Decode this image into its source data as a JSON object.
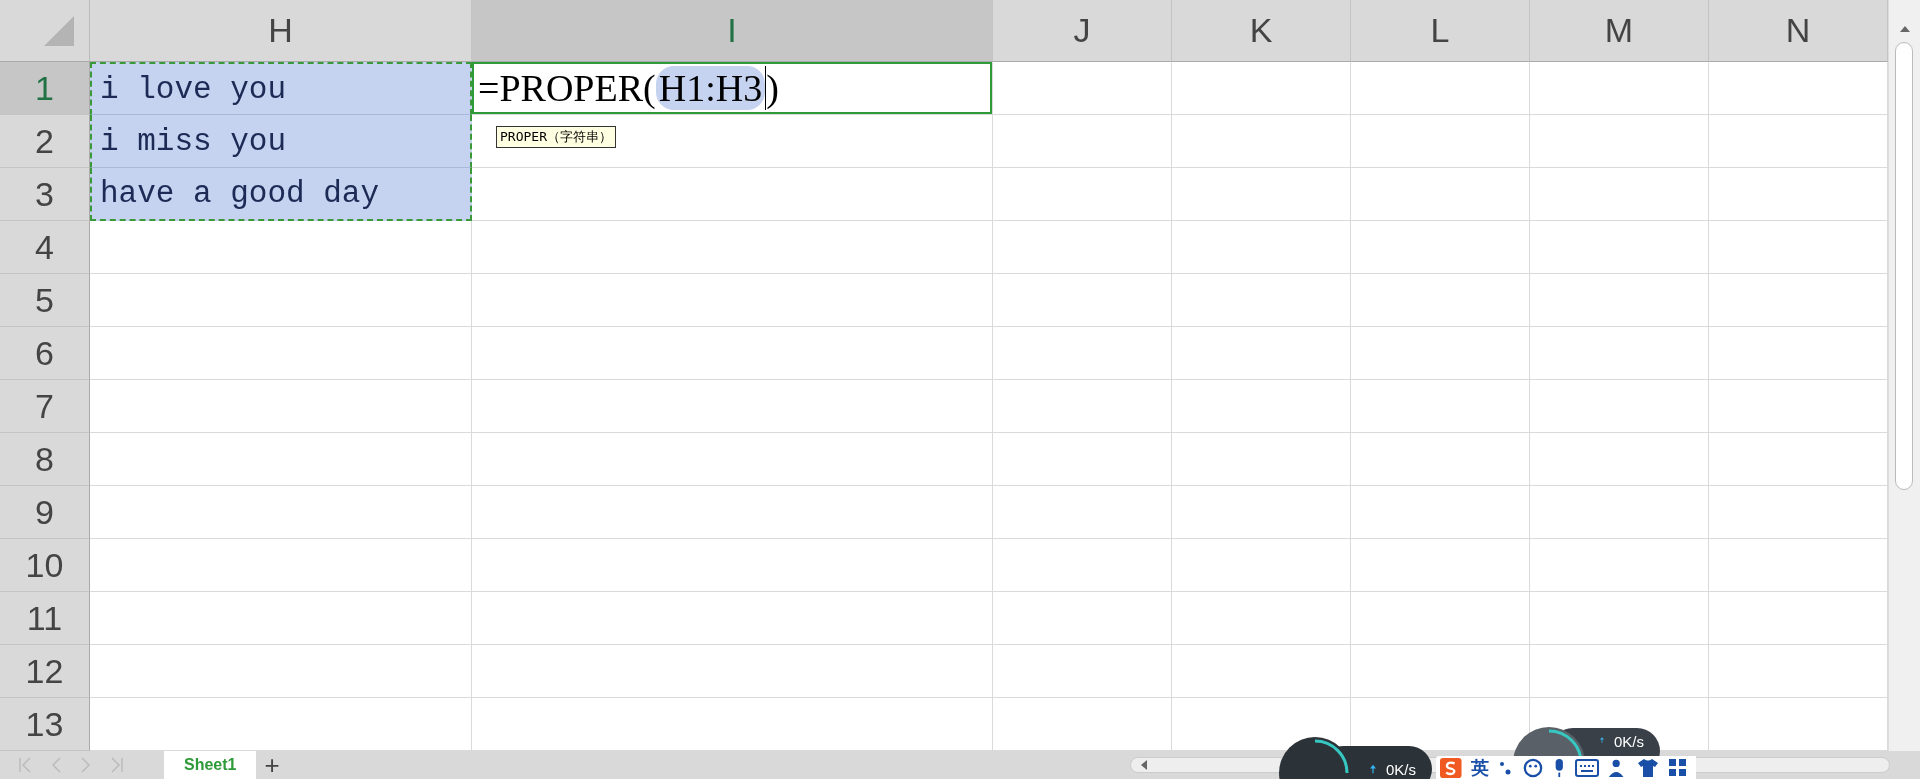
{
  "column_headers": [
    {
      "label": "H",
      "selected": false
    },
    {
      "label": "I",
      "selected": true
    },
    {
      "label": "J",
      "selected": false
    },
    {
      "label": "K",
      "selected": false
    },
    {
      "label": "L",
      "selected": false
    },
    {
      "label": "M",
      "selected": false
    },
    {
      "label": "N",
      "selected": false
    }
  ],
  "row_headers": [
    {
      "label": "1",
      "selected": true
    },
    {
      "label": "2",
      "selected": false
    },
    {
      "label": "3",
      "selected": false
    },
    {
      "label": "4",
      "selected": false
    },
    {
      "label": "5",
      "selected": false
    },
    {
      "label": "6",
      "selected": false
    },
    {
      "label": "7",
      "selected": false
    },
    {
      "label": "8",
      "selected": false
    },
    {
      "label": "9",
      "selected": false
    },
    {
      "label": "10",
      "selected": false
    },
    {
      "label": "11",
      "selected": false
    },
    {
      "label": "12",
      "selected": false
    },
    {
      "label": "13",
      "selected": false
    }
  ],
  "cells": [
    {
      "text": "i love you",
      "highlighted": true
    },
    {
      "text": "i miss you",
      "highlighted": true
    },
    {
      "text": "have a good day",
      "highlighted": true
    }
  ],
  "formula_cell": {
    "prefix": "=PROPER(",
    "reference": "H1:H3",
    "suffix": ")"
  },
  "tooltip": "PROPER（字符串）",
  "sheet_tabs": [
    {
      "label": "Sheet1",
      "selected": true
    }
  ],
  "add_sheet": "+",
  "net_widgets": [
    {
      "speed": "0K/s"
    },
    {
      "speed": "0K/s"
    }
  ],
  "ime_bar": {
    "label": "英"
  }
}
